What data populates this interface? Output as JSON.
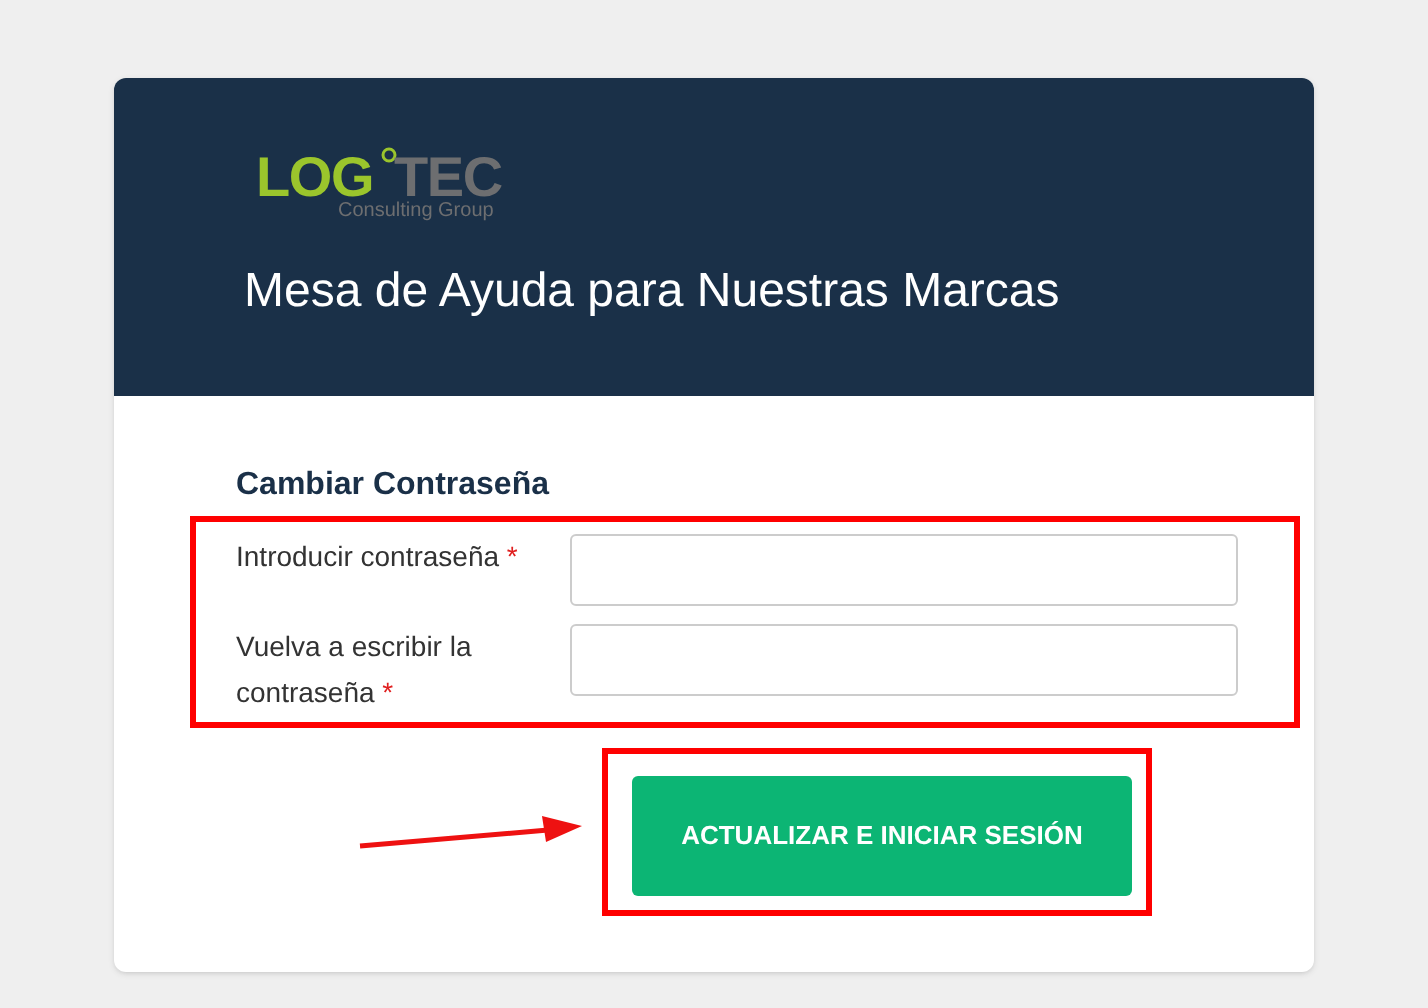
{
  "logo": {
    "primary": "LOG",
    "secondary": "TEC",
    "tagline": "Consulting Group"
  },
  "header": {
    "title": "Mesa de Ayuda para Nuestras Marcas"
  },
  "form": {
    "heading": "Cambiar Contraseña",
    "fields": [
      {
        "label": "Introducir contraseña",
        "required": true
      },
      {
        "label": "Vuelva a escribir la contraseña",
        "required": true
      }
    ],
    "required_mark": "*",
    "submit": "ACTUALIZAR E INICIAR SESIÓN"
  }
}
